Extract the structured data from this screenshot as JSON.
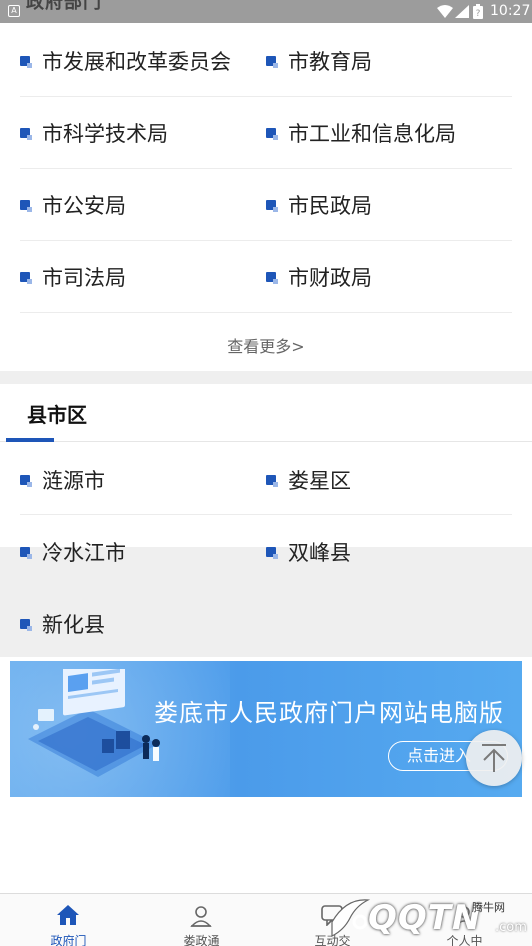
{
  "status_bar": {
    "time": "10:27",
    "peek_title": "政府部门"
  },
  "departments": {
    "rows": [
      [
        "市发展和改革委员会",
        "市教育局"
      ],
      [
        "市科学技术局",
        "市工业和信息化局"
      ],
      [
        "市公安局",
        "市民政局"
      ],
      [
        "市司法局",
        "市财政局"
      ]
    ],
    "more_label": "查看更多>"
  },
  "counties": {
    "title": "县市区",
    "rows": [
      [
        "涟源市",
        "娄星区"
      ],
      [
        "冷水江市",
        "双峰县"
      ],
      [
        "新化县",
        ""
      ]
    ]
  },
  "banner": {
    "title": "娄底市人民政府门户网站电脑版",
    "button_label": "点击进入"
  },
  "bottom_nav": [
    {
      "label": "政府门",
      "icon": "home-icon",
      "active": true
    },
    {
      "label": "娄政通",
      "icon": "user-icon",
      "active": false
    },
    {
      "label": "互动交",
      "icon": "chat-icon",
      "active": false
    },
    {
      "label": "个人中",
      "icon": "person-icon",
      "active": false
    }
  ],
  "watermark": {
    "text": "QQTN",
    "site": "腾牛网",
    "suffix": ".com"
  },
  "colors": {
    "accent": "#1e56b8",
    "banner": "#4b9bea"
  }
}
